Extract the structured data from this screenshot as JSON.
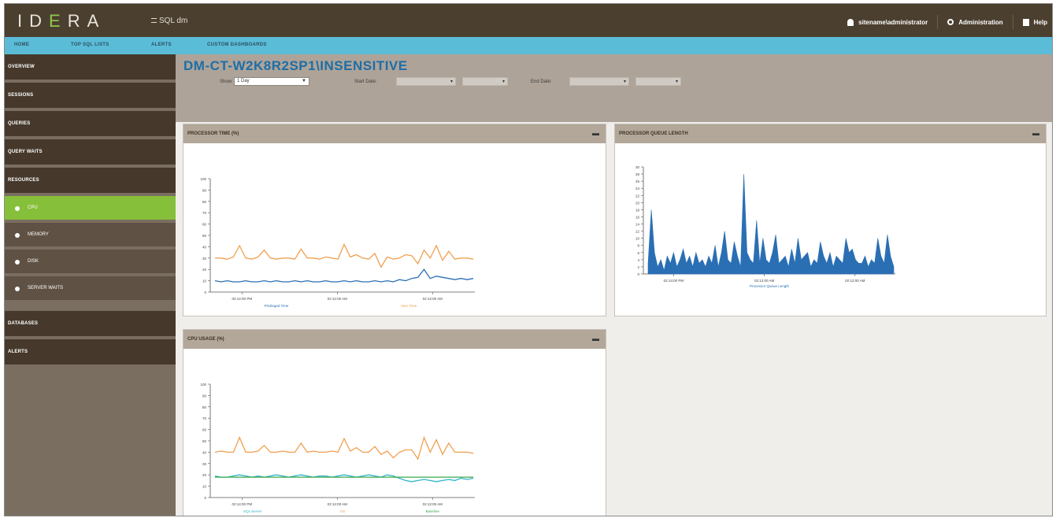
{
  "brand": {
    "logo_left": "ID",
    "logo_mid": "E",
    "logo_right": "RA"
  },
  "app": {
    "menu_label": "SQL dm"
  },
  "topbar": {
    "user_label": "sitename\\administrator",
    "admin_label": "Administration",
    "help_label": "Help"
  },
  "nav": {
    "tabs": [
      "HOME",
      "TOP SQL LISTS",
      "ALERTS",
      "CUSTOM DASHBOARDS"
    ]
  },
  "sidebar": {
    "items": [
      "OVERVIEW",
      "SESSIONS",
      "QUERIES",
      "QUERY WAITS",
      "RESOURCES",
      "DATABASES",
      "ALERTS"
    ],
    "sub_items": [
      "CPU",
      "MEMORY",
      "DISK",
      "SERVER WAITS"
    ],
    "active_sub": "CPU"
  },
  "page": {
    "title": "DM-CT-W2K8R2SP1\\INSENSITIVE",
    "show_label": "Show:",
    "show_value": "1 Day",
    "start_label": "Start Date:",
    "end_label": "End Date:"
  },
  "panels": {
    "processor_time": {
      "title": "PROCESSOR TIME (%)"
    },
    "processor_queue": {
      "title": "PROCESSOR QUEUE LENGTH"
    },
    "cpu_usage": {
      "title": "CPU USAGE (%)"
    }
  },
  "colors": {
    "topbar": "#4b3f30",
    "navbar": "#5bbcd8",
    "sidebar_dark": "#46392b",
    "active": "#86c03a",
    "title_blue": "#1d6ea7",
    "series_orange": "#f0a050",
    "series_blue": "#2a6fb4",
    "series_green": "#3aa84a",
    "series_cyan": "#2fb4c8"
  },
  "chart_data": [
    {
      "type": "line",
      "title": "PROCESSOR TIME (%)",
      "ylim": [
        0,
        100
      ],
      "yticks": [
        "0",
        "10",
        "20",
        "30",
        "40",
        "50",
        "60",
        "70",
        "80",
        "90",
        "100"
      ],
      "xticks": [
        "02:14:00 PM",
        "02:12:00 AM",
        "02:12:00 AM"
      ],
      "series": [
        {
          "name": "Privileged Time",
          "color": "#2a6fb4",
          "values": [
            10,
            9,
            10,
            9,
            9,
            10,
            9,
            9,
            10,
            9,
            10,
            9,
            9,
            10,
            9,
            10,
            9,
            9,
            10,
            9,
            9,
            10,
            9,
            10,
            9,
            9,
            10,
            9,
            10,
            9,
            11,
            10,
            12,
            13,
            20,
            12,
            14,
            13,
            12,
            11,
            12,
            11,
            12
          ]
        },
        {
          "name": "User Time",
          "color": "#f0a050",
          "values": [
            30,
            30,
            29,
            31,
            41,
            30,
            29,
            31,
            37,
            30,
            29,
            30,
            30,
            29,
            38,
            30,
            30,
            29,
            31,
            30,
            29,
            42,
            31,
            33,
            30,
            29,
            34,
            22,
            31,
            29,
            30,
            33,
            32,
            25,
            37,
            30,
            41,
            28,
            36,
            29,
            30,
            30,
            29
          ]
        }
      ]
    },
    {
      "type": "area",
      "title": "PROCESSOR QUEUE LENGTH",
      "ylim": [
        0,
        30
      ],
      "yticks": [
        "0",
        "2",
        "4",
        "6",
        "8",
        "10",
        "12",
        "14",
        "16",
        "18",
        "20",
        "22",
        "24",
        "26",
        "28",
        "30"
      ],
      "xticks": [
        "02:14:00 PM",
        "02:12:00 AM",
        "02:12:00 AM"
      ],
      "xlabel": "Processor Queue Length",
      "series": [
        {
          "name": "Processor Queue Length",
          "color": "#2a6fb4",
          "values": [
            3,
            18,
            6,
            2,
            4,
            1,
            5,
            3,
            6,
            2,
            4,
            7,
            3,
            5,
            2,
            6,
            3,
            4,
            2,
            5,
            3,
            8,
            2,
            6,
            12,
            4,
            3,
            9,
            5,
            2,
            28,
            6,
            4,
            3,
            15,
            3,
            10,
            4,
            3,
            6,
            11,
            3,
            4,
            5,
            2,
            7,
            3,
            10,
            4,
            5,
            6,
            2,
            4,
            3,
            9,
            5,
            3,
            6,
            2,
            5,
            4,
            3,
            10,
            6,
            7,
            4,
            3,
            3,
            5,
            2,
            4,
            3,
            10,
            5,
            3,
            11,
            5,
            2
          ]
        }
      ]
    },
    {
      "type": "line",
      "title": "CPU USAGE (%)",
      "ylim": [
        0,
        100
      ],
      "yticks": [
        "0",
        "10",
        "20",
        "30",
        "40",
        "50",
        "60",
        "70",
        "80",
        "90",
        "100"
      ],
      "xticks": [
        "02:14:00 PM",
        "02:12:00 AM",
        "02:12:00 AM"
      ],
      "series": [
        {
          "name": "SQL Server",
          "color": "#2fb4c8",
          "values": [
            19,
            18,
            18,
            19,
            20,
            19,
            18,
            19,
            18,
            19,
            20,
            19,
            18,
            19,
            20,
            19,
            18,
            19,
            19,
            18,
            19,
            20,
            19,
            18,
            19,
            20,
            19,
            18,
            20,
            19,
            17,
            15,
            14,
            15,
            16,
            15,
            14,
            15,
            16,
            15,
            17,
            16,
            17
          ]
        },
        {
          "name": "OS",
          "color": "#f0a050",
          "values": [
            40,
            41,
            40,
            40,
            53,
            40,
            40,
            41,
            46,
            40,
            40,
            41,
            40,
            40,
            48,
            40,
            41,
            40,
            40,
            41,
            40,
            52,
            41,
            44,
            40,
            40,
            45,
            38,
            41,
            35,
            40,
            42,
            42,
            34,
            53,
            40,
            51,
            38,
            48,
            40,
            40,
            40,
            39
          ]
        },
        {
          "name": "Baseline",
          "color": "#3aa84a",
          "values": [
            18,
            18,
            18,
            18,
            18,
            18,
            18,
            18,
            18,
            18,
            18,
            18,
            18,
            18,
            18,
            18,
            18,
            18,
            18,
            18,
            18,
            18,
            18,
            18,
            18,
            18,
            18,
            18,
            18,
            18,
            18,
            18,
            18,
            18,
            18,
            18,
            18,
            18,
            18,
            18,
            18,
            18,
            18
          ]
        }
      ]
    }
  ]
}
